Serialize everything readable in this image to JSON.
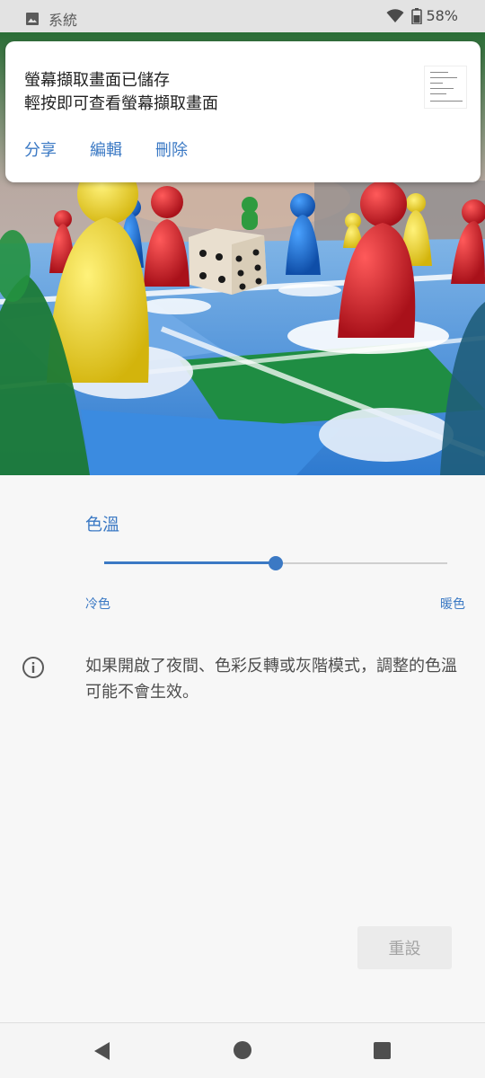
{
  "status_bar": {
    "app_label": "系統",
    "battery": "58%",
    "icons": [
      "image-icon",
      "wifi-icon",
      "battery-icon"
    ]
  },
  "notification": {
    "title": "螢幕擷取畫面已儲存",
    "subtitle": "輕按即可查看螢幕擷取畫面",
    "actions": [
      "分享",
      "編輯",
      "刪除"
    ]
  },
  "color_temperature": {
    "label": "色溫",
    "slider_value": 0.5,
    "min_label": "冷色",
    "max_label": "暖色"
  },
  "info": {
    "text": "如果開啟了夜間、色彩反轉或灰階模式，調整的色溫可能不會生效。"
  },
  "reset_button": "重設",
  "colors": {
    "accent": "#3b79c4",
    "track": "#cfcfcf"
  }
}
